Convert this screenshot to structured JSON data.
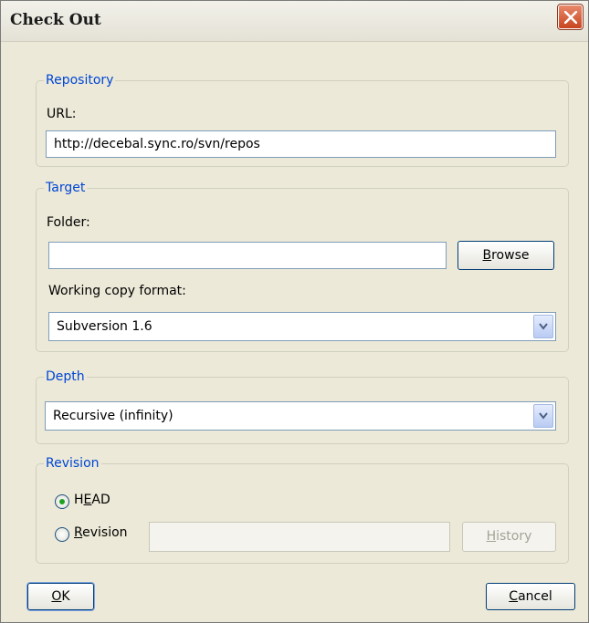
{
  "window": {
    "title": "Check Out"
  },
  "repository": {
    "legend": "Repository",
    "url_label": "URL:",
    "url_value": "http://decebal.sync.ro/svn/repos"
  },
  "target": {
    "legend": "Target",
    "folder_label": "Folder:",
    "folder_value": "",
    "browse_prefix": "",
    "browse_underline": "B",
    "browse_rest": "rowse",
    "format_label": "Working copy format:",
    "format_value": "Subversion 1.6"
  },
  "depth": {
    "legend": "Depth",
    "value": "Recursive (infinity)"
  },
  "revision": {
    "legend": "Revision",
    "head_prefix": "H",
    "head_underline": "E",
    "head_rest": "AD",
    "head_selected": true,
    "revision_underline": "R",
    "revision_rest": "evision",
    "revision_value": "",
    "history_underline": "H",
    "history_rest": "istory"
  },
  "footer": {
    "ok_underline": "O",
    "ok_rest": "K",
    "cancel_underline": "C",
    "cancel_rest": "ancel"
  },
  "colors": {
    "legend": "#0046d5",
    "close_button": "#c8451f",
    "radio_selected": "#21a121"
  },
  "icons": [
    "close-icon",
    "chevron-down-icon",
    "radio-selected-icon",
    "radio-unselected-icon"
  ]
}
